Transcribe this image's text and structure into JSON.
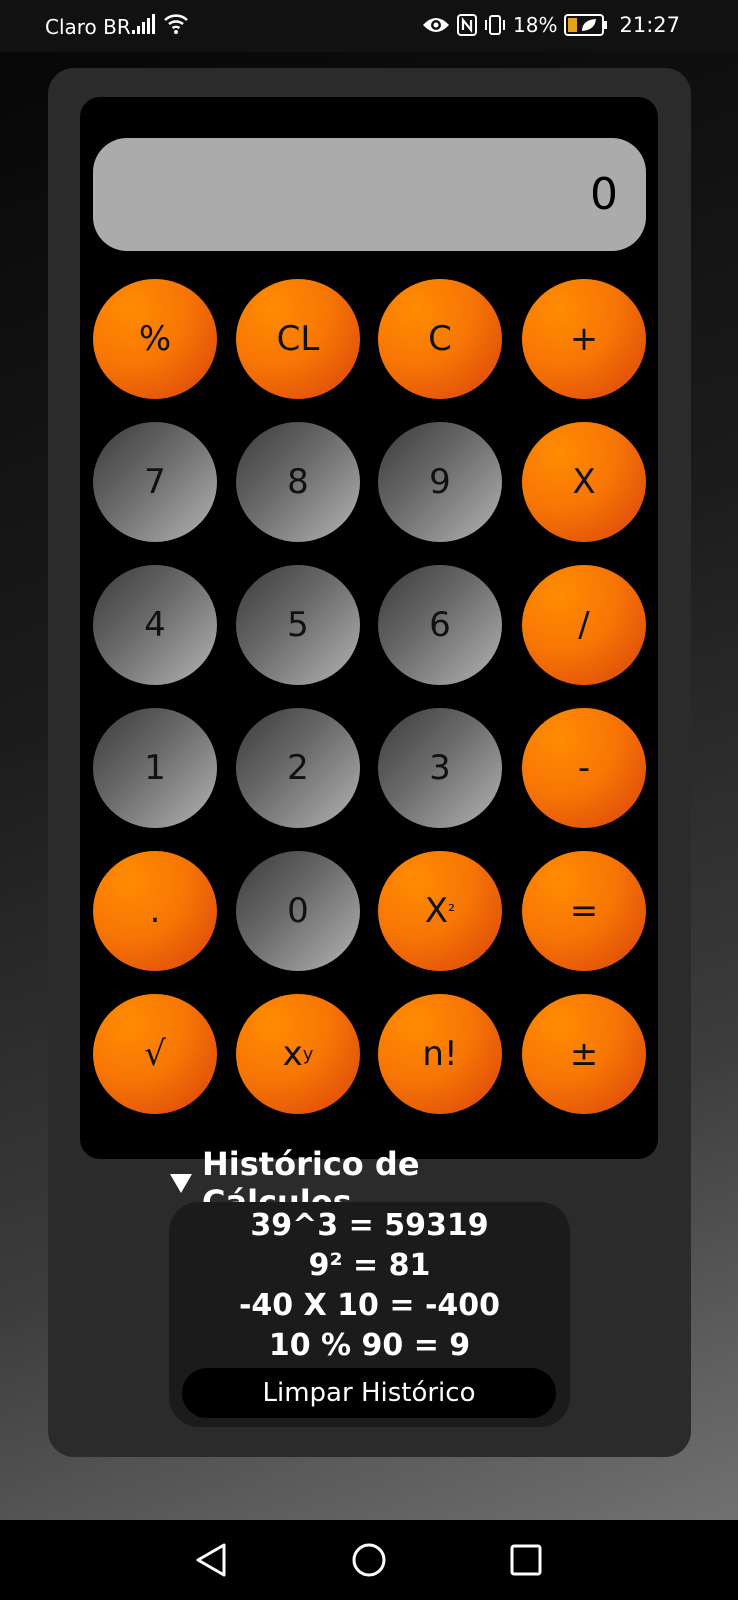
{
  "status_bar": {
    "carrier": "Claro BR",
    "battery": "18%",
    "time": "21:27"
  },
  "display": {
    "value": "0"
  },
  "keys": {
    "percent": "%",
    "clear_last": "CL",
    "clear": "C",
    "plus": "+",
    "seven": "7",
    "eight": "8",
    "nine": "9",
    "multiply": "X",
    "four": "4",
    "five": "5",
    "six": "6",
    "divide": "/",
    "one": "1",
    "two": "2",
    "three": "3",
    "minus": "-",
    "dot": ".",
    "zero": "0",
    "square_base": "X",
    "square_exp": "²",
    "equals": "=",
    "sqrt": "√",
    "power_base": "x",
    "power_exp": "y",
    "factorial": "n!",
    "plus_minus": "±"
  },
  "history": {
    "title": "Histórico de Cálculos",
    "items": [
      "39^3 = 59319",
      "9² = 81",
      "-40 X 10 = -400",
      "10 % 90 = 9"
    ],
    "clear_label": "Limpar Histórico"
  },
  "colors": {
    "accent_orange": "#f77606",
    "display_bg": "#ababab",
    "panel_bg": "#000000"
  }
}
